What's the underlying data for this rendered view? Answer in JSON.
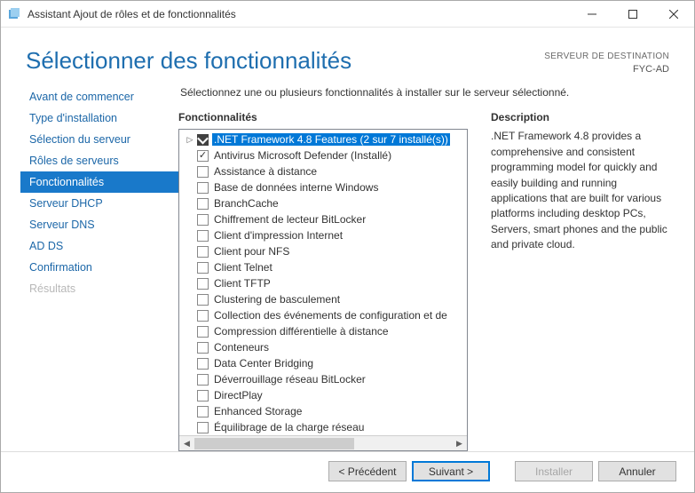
{
  "window": {
    "title": "Assistant Ajout de rôles et de fonctionnalités"
  },
  "header": {
    "page_title": "Sélectionner des fonctionnalités",
    "dest_label": "SERVEUR DE DESTINATION",
    "dest_value": "FYC-AD"
  },
  "sidebar": {
    "items": [
      {
        "label": "Avant de commencer",
        "state": "normal"
      },
      {
        "label": "Type d'installation",
        "state": "normal"
      },
      {
        "label": "Sélection du serveur",
        "state": "normal"
      },
      {
        "label": "Rôles de serveurs",
        "state": "normal"
      },
      {
        "label": "Fonctionnalités",
        "state": "active"
      },
      {
        "label": "Serveur DHCP",
        "state": "normal"
      },
      {
        "label": "Serveur DNS",
        "state": "normal"
      },
      {
        "label": "AD DS",
        "state": "normal"
      },
      {
        "label": "Confirmation",
        "state": "normal"
      },
      {
        "label": "Résultats",
        "state": "disabled"
      }
    ]
  },
  "main": {
    "intro": "Sélectionnez une ou plusieurs fonctionnalités à installer sur le serveur sélectionné.",
    "features_heading": "Fonctionnalités",
    "description_heading": "Description",
    "description_body": ".NET Framework 4.8 provides a comprehensive and consistent programming model for quickly and easily building and running applications that are built for various platforms including desktop PCs, Servers, smart phones and the public and private cloud.",
    "features": [
      {
        "label": ".NET Framework 4.8 Features (2 sur 7 installé(s))",
        "expand": "closed",
        "check": "black",
        "selected": true
      },
      {
        "label": "Antivirus Microsoft Defender (Installé)",
        "expand": "none",
        "check": "checked",
        "selected": false
      },
      {
        "label": "Assistance à distance",
        "expand": "none",
        "check": "unchecked",
        "selected": false
      },
      {
        "label": "Base de données interne Windows",
        "expand": "none",
        "check": "unchecked",
        "selected": false
      },
      {
        "label": "BranchCache",
        "expand": "none",
        "check": "unchecked",
        "selected": false
      },
      {
        "label": "Chiffrement de lecteur BitLocker",
        "expand": "none",
        "check": "unchecked",
        "selected": false
      },
      {
        "label": "Client d'impression Internet",
        "expand": "none",
        "check": "unchecked",
        "selected": false
      },
      {
        "label": "Client pour NFS",
        "expand": "none",
        "check": "unchecked",
        "selected": false
      },
      {
        "label": "Client Telnet",
        "expand": "none",
        "check": "unchecked",
        "selected": false
      },
      {
        "label": "Client TFTP",
        "expand": "none",
        "check": "unchecked",
        "selected": false
      },
      {
        "label": "Clustering de basculement",
        "expand": "none",
        "check": "unchecked",
        "selected": false
      },
      {
        "label": "Collection des événements de configuration et de",
        "expand": "none",
        "check": "unchecked",
        "selected": false
      },
      {
        "label": "Compression différentielle à distance",
        "expand": "none",
        "check": "unchecked",
        "selected": false
      },
      {
        "label": "Conteneurs",
        "expand": "none",
        "check": "unchecked",
        "selected": false
      },
      {
        "label": "Data Center Bridging",
        "expand": "none",
        "check": "unchecked",
        "selected": false
      },
      {
        "label": "Déverrouillage réseau BitLocker",
        "expand": "none",
        "check": "unchecked",
        "selected": false
      },
      {
        "label": "DirectPlay",
        "expand": "none",
        "check": "unchecked",
        "selected": false
      },
      {
        "label": "Enhanced Storage",
        "expand": "none",
        "check": "unchecked",
        "selected": false
      },
      {
        "label": "Équilibrage de la charge réseau",
        "expand": "none",
        "check": "unchecked",
        "selected": false
      }
    ]
  },
  "footer": {
    "previous": "< Précédent",
    "next": "Suivant >",
    "install": "Installer",
    "cancel": "Annuler"
  }
}
